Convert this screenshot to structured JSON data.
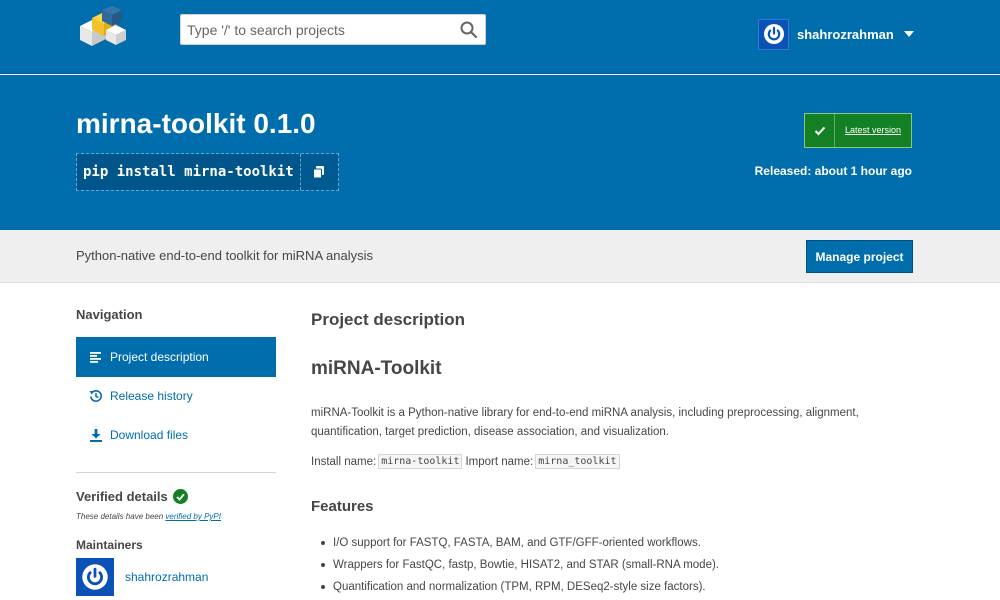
{
  "search": {
    "placeholder": "Type '/' to search projects"
  },
  "user": {
    "name": "shahrozrahman"
  },
  "header": {
    "title": "mirna-toolkit 0.1.0",
    "pip_command": "pip install mirna-toolkit",
    "latest_label": "Latest version",
    "released": "Released: about 1 hour ago"
  },
  "summary": {
    "text": "Python-native end-to-end toolkit for miRNA analysis",
    "manage_label": "Manage project"
  },
  "sidebar": {
    "heading": "Navigation",
    "items": [
      {
        "label": "Project description",
        "icon": "align-left-icon"
      },
      {
        "label": "Release history",
        "icon": "history-icon"
      },
      {
        "label": "Download files",
        "icon": "download-icon"
      }
    ],
    "verified_heading": "Verified details",
    "verified_note_prefix": "These details have been ",
    "verified_note_link": "verified by PyPI",
    "maintainers_heading": "Maintainers",
    "maintainer_name": "shahrozrahman"
  },
  "main": {
    "desc_heading": "Project description",
    "project_heading": "miRNA-Toolkit",
    "paragraph": "miRNA-Toolkit is a Python-native library for end-to-end miRNA analysis, including preprocessing, alignment, quantification, target prediction, disease association, and visualization.",
    "install_label": "Install name:",
    "install_name": "mirna-toolkit",
    "import_label": "Import name:",
    "import_name": "mirna_toolkit",
    "features_heading": "Features",
    "features": [
      "I/O support for FASTQ, FASTA, BAM, and GTF/GFF-oriented workflows.",
      "Wrappers for FastQC, fastp, Bowtie, HISAT2, and STAR (small-RNA mode).",
      "Quantification and normalization (TPM, RPM, DESeq2-style size factors)."
    ]
  },
  "colors": {
    "brand_blue": "#006dad",
    "success_green": "#148024",
    "summary_bg": "#efefef"
  }
}
